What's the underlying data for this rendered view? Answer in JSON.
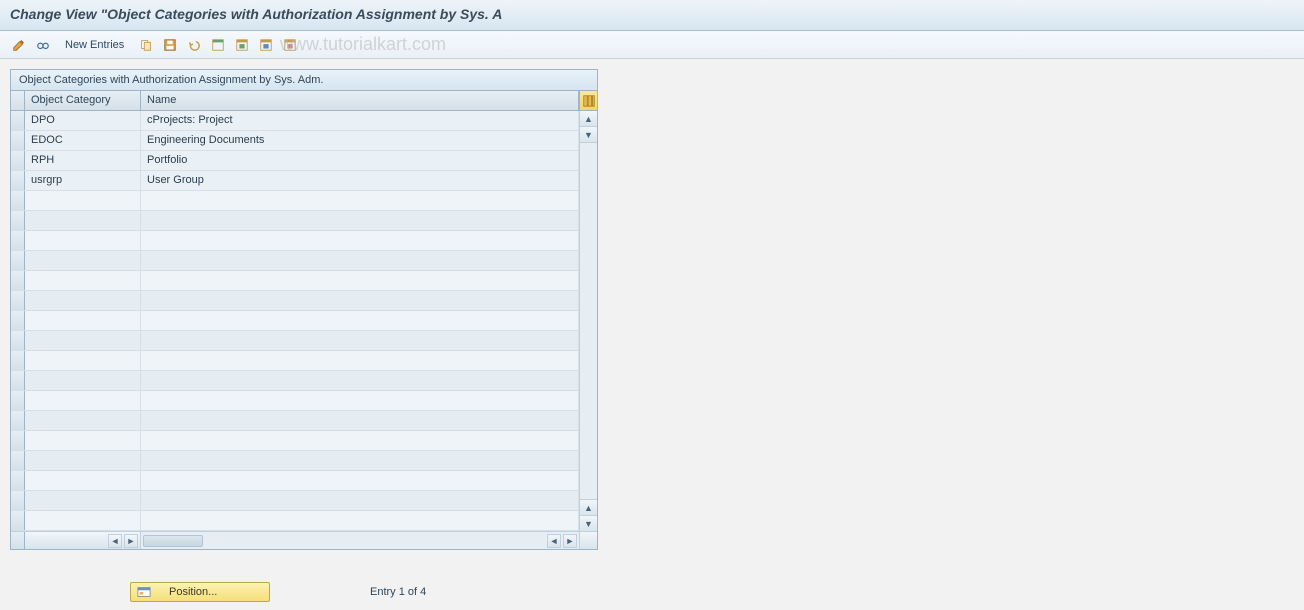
{
  "header": {
    "title": "Change View \"Object Categories with Authorization Assignment by Sys. A"
  },
  "toolbar": {
    "new_entries_label": "New Entries"
  },
  "watermark": "www.tutorialkart.com",
  "panel": {
    "title": "Object Categories with Authorization Assignment by Sys. Adm.",
    "columns": {
      "c1": "Object Category",
      "c2": "Name"
    }
  },
  "rows": [
    {
      "cat": "DPO",
      "name": "cProjects: Project"
    },
    {
      "cat": "EDOC",
      "name": "Engineering Documents"
    },
    {
      "cat": "RPH",
      "name": "Portfolio"
    },
    {
      "cat": "usrgrp",
      "name": "User Group"
    }
  ],
  "empty_row_count": 17,
  "footer": {
    "position_label": "Position...",
    "entry_text": "Entry 1 of 4"
  }
}
